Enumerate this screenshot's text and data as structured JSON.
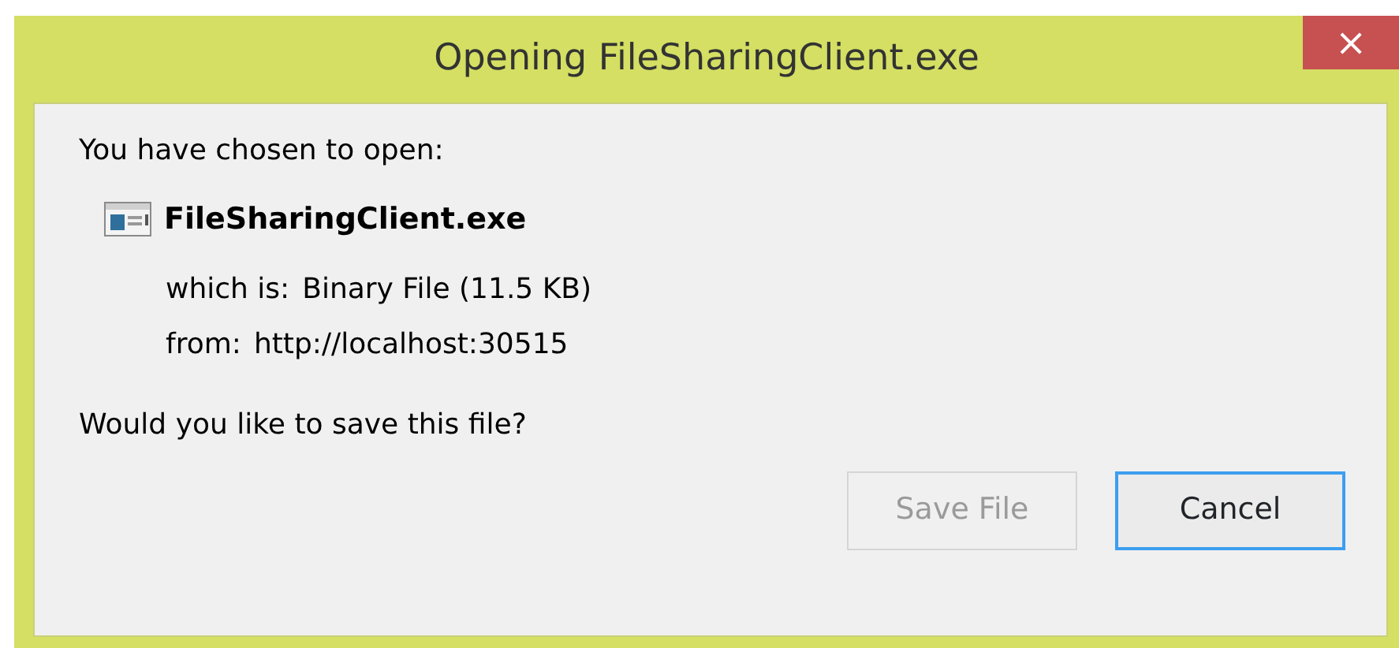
{
  "window": {
    "title": "Opening FileSharingClient.exe",
    "close": "×"
  },
  "intro": "You have chosen to open:",
  "file": {
    "name": "FileSharingClient.exe",
    "details": [
      {
        "label": "which is:",
        "value": "Binary File (11.5 KB)"
      },
      {
        "label": "from:",
        "value": "http://localhost:30515"
      }
    ]
  },
  "question": "Would you like to save this file?",
  "buttons": [
    {
      "label": "Save File",
      "disabled": true,
      "focused": false
    },
    {
      "label": "Cancel",
      "disabled": false,
      "focused": true
    }
  ]
}
